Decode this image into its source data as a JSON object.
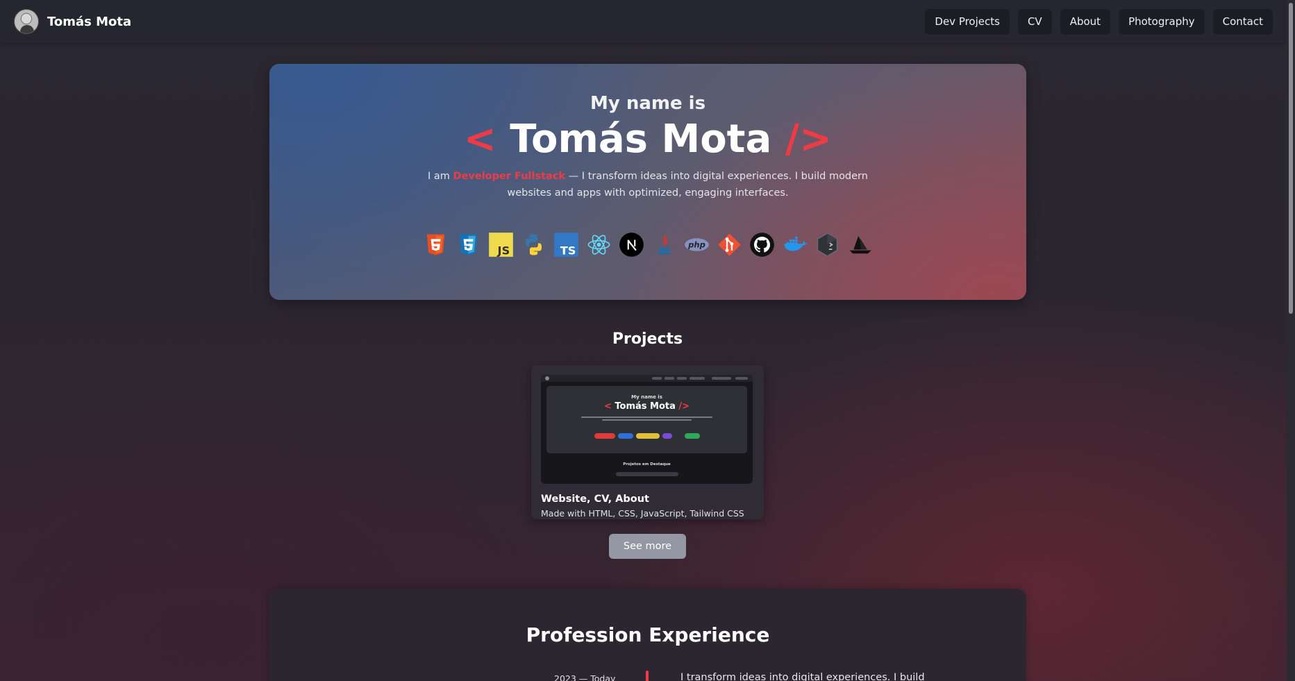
{
  "navbar": {
    "brand_name": "Tomás Mota",
    "links": [
      "Dev Projects",
      "CV",
      "About",
      "Photography",
      "Contact"
    ]
  },
  "hero": {
    "intro": "My name is",
    "name": "Tomás Mota",
    "open_bracket": "<",
    "close_bracket": "/>",
    "desc_prefix": "I am ",
    "role": "Developer Fullstack",
    "desc_suffix": " — I transform ideas into digital experiences. I build modern websites and apps with optimized, engaging interfaces.",
    "tech_icons": [
      "html5-icon",
      "css3-icon",
      "javascript-icon",
      "python-icon",
      "typescript-icon",
      "react-icon",
      "nextjs-icon",
      "java-icon",
      "php-icon",
      "git-icon",
      "github-icon",
      "docker-icon",
      "bash-icon",
      "arch-boat-icon"
    ]
  },
  "projects": {
    "title": "Projects",
    "cards": [
      {
        "title": "Website, CV, About",
        "subtitle": "Made with HTML, CSS, JavaScript, Tailwind CSS",
        "thumb_intro": "My name is",
        "thumb_name": "Tomás Mota",
        "thumb_section": "Projetos em Destaque"
      }
    ],
    "see_more_label": "See more"
  },
  "experience": {
    "title": "Profession Experience",
    "date": "2023 — Today",
    "text": "I transform ideas into digital experiences. I build"
  },
  "colors": {
    "accent": "#ef3b45",
    "nav_bg": "#262630",
    "button_bg": "#1c1c24"
  }
}
